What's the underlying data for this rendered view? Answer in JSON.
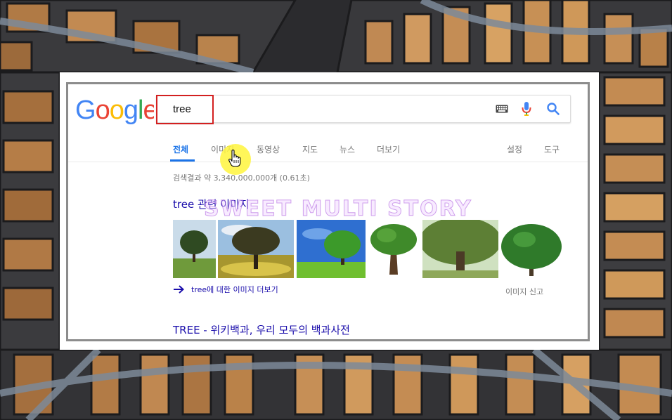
{
  "search": {
    "logo_text": "Google",
    "query": "tree"
  },
  "tabs": [
    {
      "label": "전체",
      "active": true
    },
    {
      "label": "이미지",
      "active": false
    },
    {
      "label": "동영상",
      "active": false
    },
    {
      "label": "지도",
      "active": false
    },
    {
      "label": "뉴스",
      "active": false
    },
    {
      "label": "더보기",
      "active": false
    },
    {
      "label": "설정",
      "active": false
    },
    {
      "label": "도구",
      "active": false
    }
  ],
  "results": {
    "stats": "검색결과 약 3,340,000,000개 (0.61초)",
    "images_heading": "tree 관련 이미지",
    "more_images": "tree에 대한 이미지 더보기",
    "report_images": "이미지 신고",
    "first_result_title": "TREE - 위키백과, 우리 모두의 백과사전"
  },
  "watermark": "SWEET MULTI STORY",
  "colors": {
    "link": "#1a0dab",
    "active_tab": "#1a73e8",
    "query_highlight": "#d32020",
    "cursor_halo": "#fff53c"
  },
  "icons": [
    "keyboard-icon",
    "microphone-icon",
    "search-icon",
    "hand-pointer-icon",
    "arrow-right-icon"
  ]
}
